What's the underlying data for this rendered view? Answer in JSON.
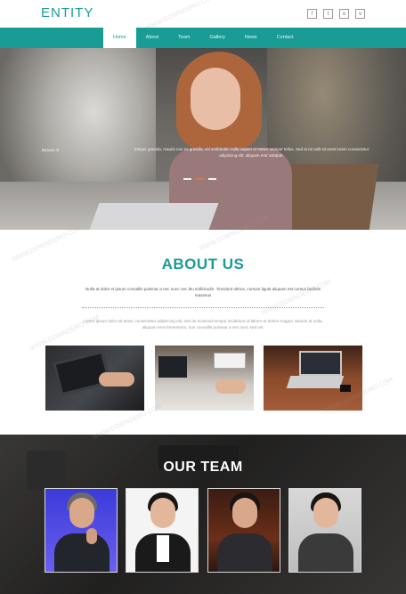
{
  "header": {
    "logo": "ENTITY",
    "social": [
      {
        "icon": "facebook-icon",
        "glyph": "f"
      },
      {
        "icon": "twitter-icon",
        "glyph": "t"
      },
      {
        "icon": "instagram-icon",
        "glyph": "o"
      },
      {
        "icon": "vimeo-icon",
        "glyph": "v"
      }
    ]
  },
  "nav": {
    "items": [
      "Home",
      "About",
      "Team",
      "Gallery",
      "News",
      "Contact"
    ],
    "active": "Home"
  },
  "hero": {
    "small_label": "Beaute nt",
    "caption": "Integer gravida, mauris non ex gravida, vel sollicitudin nulla sapien et metus semper tellus. Sed at mi velit sit amet lorem consectetur adipiscing elit, aliquam erat volutpat."
  },
  "about": {
    "title": "ABOUT US",
    "text1": "Nulla at dolor et ipsum convallis pulvinar a nec nunc nec ibu sollicitudin. Tincidunt ultrica, cursum ligula aliquam est cursus facilisis maximus",
    "text2": "Lorem ipsum dolor sit amet, consectetur adipiscing elit, sed do eiusmod tempor incididunt ut labore et dolore magna. Mauris at nulla, aliquam eros fermentum, non convallis pulvinar a nec nunc sed vel."
  },
  "team": {
    "title": "OUR TEAM"
  },
  "watermark": "WWW.DOWNDEMO.COM",
  "colors": {
    "accent": "#189c95",
    "nav_text": "#e9fbf9",
    "slider_active": "#e07a3a"
  }
}
